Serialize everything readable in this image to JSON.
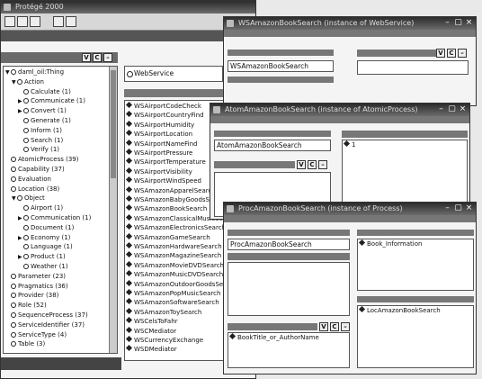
{
  "main_window": {
    "title": "Protégé 2000",
    "tree_root": "daml_oil:Thing",
    "tree": [
      {
        "label": "daml_oil:Thing",
        "depth": 0,
        "exp": "▼"
      },
      {
        "label": "Action",
        "depth": 1,
        "exp": "▼"
      },
      {
        "label": "Calculate  (1)",
        "depth": 2,
        "exp": ""
      },
      {
        "label": "Communicate  (1)",
        "depth": 2,
        "exp": "▶"
      },
      {
        "label": "Convert  (1)",
        "depth": 2,
        "exp": "▶"
      },
      {
        "label": "Generate  (1)",
        "depth": 2,
        "exp": ""
      },
      {
        "label": "Inform  (1)",
        "depth": 2,
        "exp": ""
      },
      {
        "label": "Search  (1)",
        "depth": 2,
        "exp": ""
      },
      {
        "label": "Verify  (1)",
        "depth": 2,
        "exp": ""
      },
      {
        "label": "AtomicProcess  (39)",
        "depth": 0,
        "exp": ""
      },
      {
        "label": "Capability  (37)",
        "depth": 0,
        "exp": ""
      },
      {
        "label": "Evaluation",
        "depth": 0,
        "exp": ""
      },
      {
        "label": "Location  (38)",
        "depth": 0,
        "exp": ""
      },
      {
        "label": "Object",
        "depth": 1,
        "exp": "▼"
      },
      {
        "label": "Airport  (1)",
        "depth": 2,
        "exp": ""
      },
      {
        "label": "Communication  (1)",
        "depth": 2,
        "exp": "▶"
      },
      {
        "label": "Document  (1)",
        "depth": 2,
        "exp": ""
      },
      {
        "label": "Economy  (1)",
        "depth": 2,
        "exp": "▶"
      },
      {
        "label": "Language  (1)",
        "depth": 2,
        "exp": ""
      },
      {
        "label": "Product  (1)",
        "depth": 2,
        "exp": "▶"
      },
      {
        "label": "Weather  (1)",
        "depth": 2,
        "exp": ""
      },
      {
        "label": "Parameter  (23)",
        "depth": 0,
        "exp": ""
      },
      {
        "label": "Pragmatics  (36)",
        "depth": 0,
        "exp": ""
      },
      {
        "label": "Provider  (38)",
        "depth": 0,
        "exp": ""
      },
      {
        "label": "Role  (52)",
        "depth": 0,
        "exp": ""
      },
      {
        "label": "SequenceProcess  (37)",
        "depth": 0,
        "exp": ""
      },
      {
        "label": "ServiceIdentifier  (37)",
        "depth": 0,
        "exp": ""
      },
      {
        "label": "ServiceType  (4)",
        "depth": 0,
        "exp": ""
      },
      {
        "label": "Table  (3)",
        "depth": 0,
        "exp": ""
      }
    ],
    "instances_header": "WebService",
    "instances": [
      "WSAirportCodeCheck",
      "WSAirportCountryFind",
      "WSAirportHumidity",
      "WSAirportLocation",
      "WSAirportNameFind",
      "WSAirportPressure",
      "WSAirportTemperature",
      "WSAirportVisibility",
      "WSAirportWindSpeed",
      "WSAmazonApparelSearch",
      "WSAmazonBabyGoodsSearch",
      "WSAmazonBookSearch",
      "WSAmazonClassicalMusicSearch",
      "WSAmazonElectronicsSearch",
      "WSAmazonGameSearch",
      "WSAmazonHardwareSearch",
      "WSAmazonMagazineSearch",
      "WSAmazonMovieDVDSearch",
      "WSAmazonMusicDVDSearch",
      "WSAmazonOutdoorGoodsSearch",
      "WSAmazonPopMusicSearch",
      "WSAmazonSoftwareSearch",
      "WSAmazonToySearch",
      "WSCelsToFahr",
      "WSCMediator",
      "WSCurrencyExchange",
      "WSDMediator"
    ]
  },
  "win1": {
    "title": "WSAmazonBookSearch  (instance of WebService)",
    "name_value": "WSAmazonBookSearch"
  },
  "win2": {
    "title": "AtomAmazonBookSearch  (instance of AtomicProcess)",
    "name_value": "AtomAmazonBookSearch",
    "list_item": "1"
  },
  "win3": {
    "title": "ProcAmazonBookSearch  (instance of Process)",
    "name_value": "ProcAmazonBookSearch",
    "output_item": "Book_Information",
    "input_item": "BookTitle_or_AuthorName",
    "location_item": "LocAmazonBookSearch"
  },
  "controls": {
    "minimize": "–",
    "maximize": "▢",
    "close": "×",
    "view": "V",
    "create": "C",
    "remove": "–"
  }
}
